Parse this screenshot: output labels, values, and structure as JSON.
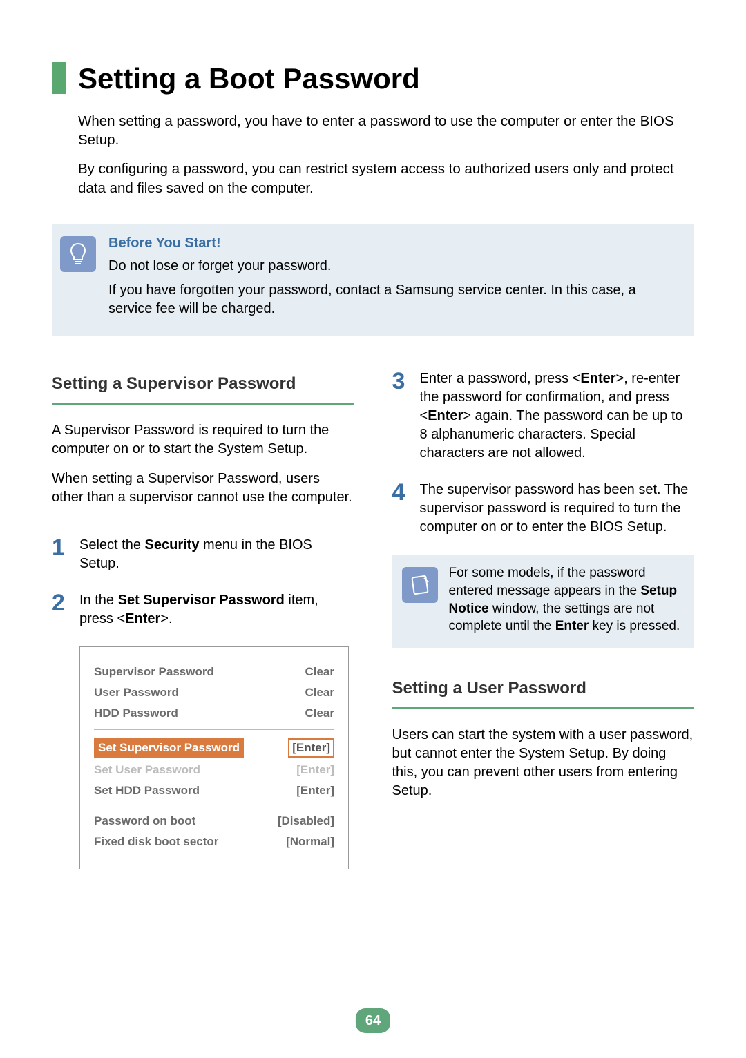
{
  "title": "Setting a Boot Password",
  "intro": {
    "p1": "When setting a password, you have to enter a password to use the computer or enter the BIOS Setup.",
    "p2": "By configuring a password, you can restrict system access to authorized users only and protect data and files saved on the computer."
  },
  "callout": {
    "title": "Before You Start!",
    "p1": "Do not lose or forget your password.",
    "p2": "If you have forgotten your password, contact a Samsung service center. In this case, a service fee will be charged."
  },
  "left": {
    "heading": "Setting a Supervisor Password",
    "p1": "A Supervisor Password is required to turn the computer on or to start the System Setup.",
    "p2": "When setting a Supervisor Password, users other than a supervisor cannot use the computer.",
    "step1_a": "Select the ",
    "step1_b": "Security",
    "step1_c": " menu in the BIOS Setup.",
    "step2_a": "In the ",
    "step2_b": "Set Supervisor Password",
    "step2_c": " item, press <",
    "step2_d": "Enter",
    "step2_e": ">."
  },
  "bios": {
    "rows_top": [
      {
        "label": "Supervisor Password",
        "value": "Clear"
      },
      {
        "label": "User Password",
        "value": "Clear"
      },
      {
        "label": "HDD Password",
        "value": "Clear"
      }
    ],
    "selected": {
      "label": "Set Supervisor Password",
      "value": "[Enter]"
    },
    "rows_mid": [
      {
        "label": "Set User Password",
        "value": "[Enter]"
      },
      {
        "label": "Set HDD Password",
        "value": "[Enter]"
      }
    ],
    "rows_bot": [
      {
        "label": "Password on boot",
        "value": "[Disabled]"
      },
      {
        "label": "Fixed disk boot sector",
        "value": "[Normal]"
      }
    ]
  },
  "right": {
    "step3_a": "Enter a password, press <",
    "step3_b": "Enter",
    "step3_c": ">, re-enter the password for confirmation, and press <",
    "step3_d": "Enter",
    "step3_e": "> again. The password can be up to 8 alphanumeric characters. Special characters are not allowed.",
    "step4": "The supervisor password has been set. The supervisor password is required to turn the computer on or to enter the BIOS Setup.",
    "note_a": "For some models, if the password entered message appears in the ",
    "note_b": "Setup Notice",
    "note_c": " window, the settings are not complete until the ",
    "note_d": "Enter",
    "note_e": " key is pressed.",
    "heading2": "Setting a User Password",
    "p_user": "Users can start the system with a user password, but cannot enter the System Setup. By doing this, you can prevent other users from entering Setup."
  },
  "page_number": "64"
}
